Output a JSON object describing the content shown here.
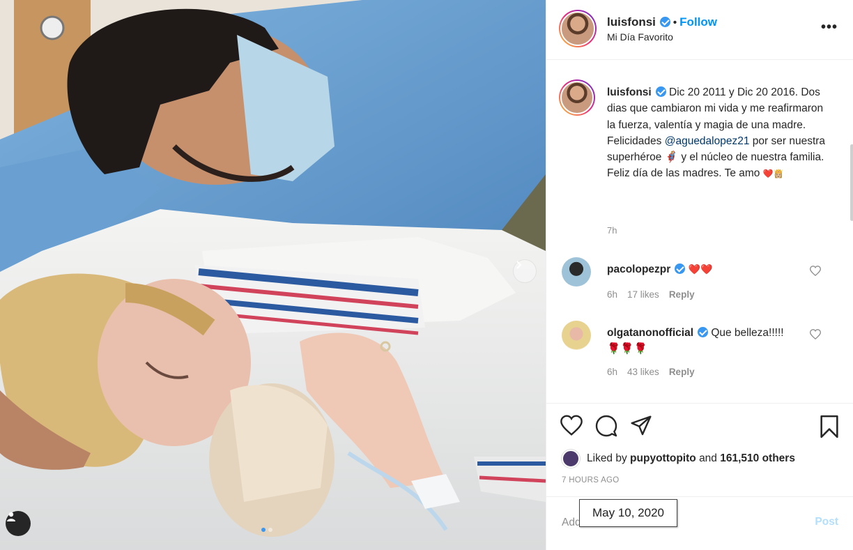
{
  "post": {
    "username": "luisfonsi",
    "follow_label": "Follow",
    "separator": "•",
    "location": "Mi Día Favorito",
    "more_label": "•••"
  },
  "caption": {
    "username": "luisfonsi",
    "text_before_mention": "Dic 20 2011 y Dic 20 2016. Dos dias que cambiaron mi vida y me reafirmaron la fuerza, valentía y magia de una madre. Felicidades",
    "mention": "@aguedalopez21",
    "text_after_mention": "por ser nuestra superhéroe",
    "emoji_1": "🦸🏼‍♀️",
    "text_after_emoji": "y el núcleo de nuestra familia. Feliz día de las madres. Te amo",
    "emoji_2": "❤️👸🏼",
    "time": "7h"
  },
  "comments": [
    {
      "username": "pacolopezpr",
      "text": "❤️❤️",
      "time": "6h",
      "likes": "17 likes",
      "reply": "Reply"
    },
    {
      "username": "olgatanonofficial",
      "text": "Que belleza!!!!!🌹🌹🌹",
      "time": "6h",
      "likes": "43 likes",
      "reply": "Reply"
    }
  ],
  "liked_by": {
    "prefix": "Liked by",
    "user": "pupyottopito",
    "middle": "and",
    "others": "161,510 others"
  },
  "time_ago": "7 HOURS AGO",
  "add_comment": {
    "placeholder": "Add a comment...",
    "post_label": "Post"
  },
  "tooltip": "May 10, 2020",
  "icons": {
    "like": "heart-icon",
    "comment": "comment-icon",
    "share": "share-icon",
    "save": "bookmark-icon",
    "user_tag": "user-icon",
    "next": "chevron-right-icon"
  },
  "colors": {
    "accent": "#0095f6",
    "verified": "#3897f0",
    "heart": "#ed1c24"
  }
}
